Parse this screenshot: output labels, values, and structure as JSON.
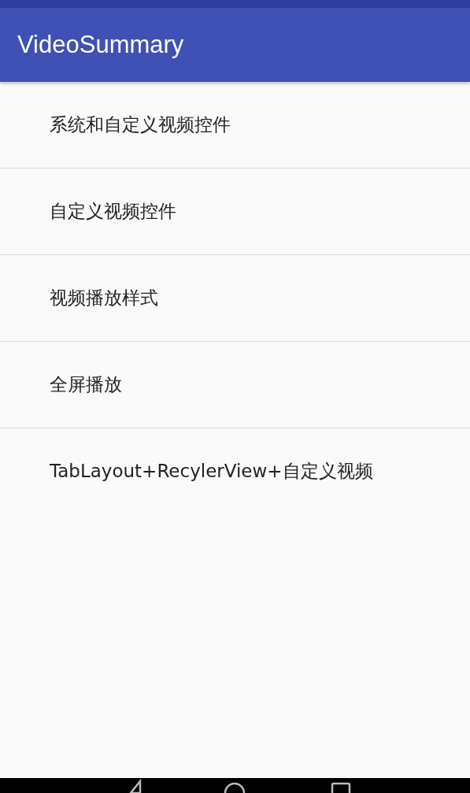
{
  "app_bar": {
    "title": "VideoSummary"
  },
  "list": [
    {
      "label": "系统和自定义视频控件"
    },
    {
      "label": "自定义视频控件"
    },
    {
      "label": "视频播放样式"
    },
    {
      "label": "全屏播放"
    },
    {
      "label": "TabLayout+RecylerView+自定义视频"
    }
  ]
}
